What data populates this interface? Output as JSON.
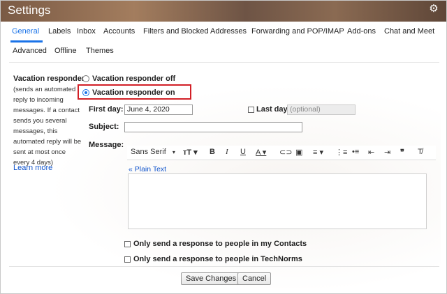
{
  "window": {
    "title": "Settings"
  },
  "tabs_row1": [
    {
      "label": "General",
      "active": true
    },
    {
      "label": "Labels"
    },
    {
      "label": "Inbox"
    },
    {
      "label": "Accounts"
    },
    {
      "label": "Filters and Blocked Addresses"
    },
    {
      "label": "Forwarding and POP/IMAP"
    },
    {
      "label": "Add-ons"
    },
    {
      "label": "Chat and Meet"
    }
  ],
  "tabs_row2": [
    {
      "label": "Advanced"
    },
    {
      "label": "Offline"
    },
    {
      "label": "Themes"
    }
  ],
  "vacation": {
    "label": "Vacation responder:",
    "description": "(sends an automated reply to incoming messages. If a contact sends you several messages, this automated reply will be sent at most once every 4 days)",
    "learn_more": "Learn more",
    "off_label": "Vacation responder off",
    "on_label": "Vacation responder on",
    "selected": "on",
    "first_day_label": "First day:",
    "first_day_value": "June 4, 2020",
    "last_day_label": "Last day:",
    "last_day_placeholder": "(optional)",
    "subject_label": "Subject:",
    "subject_value": "",
    "message_label": "Message:"
  },
  "editor": {
    "font_name": "Sans Serif",
    "plain_text_link": "« Plain Text",
    "toolbar_icons": [
      "font-family-dropdown",
      "font-size-icon",
      "bold-icon",
      "italic-icon",
      "underline-icon",
      "text-color-icon",
      "link-icon",
      "image-icon",
      "align-icon",
      "numbered-list-icon",
      "bulleted-list-icon",
      "indent-less-icon",
      "indent-more-icon",
      "quote-icon",
      "remove-formatting-icon"
    ]
  },
  "options": {
    "contacts_only": "Only send a response to people in my Contacts",
    "org_only": "Only send a response to people in TechNorms"
  },
  "buttons": {
    "save": "Save Changes",
    "cancel": "Cancel"
  },
  "colors": {
    "accent": "#1a73e8",
    "link": "#1155cc",
    "highlight": "#d21f26"
  }
}
